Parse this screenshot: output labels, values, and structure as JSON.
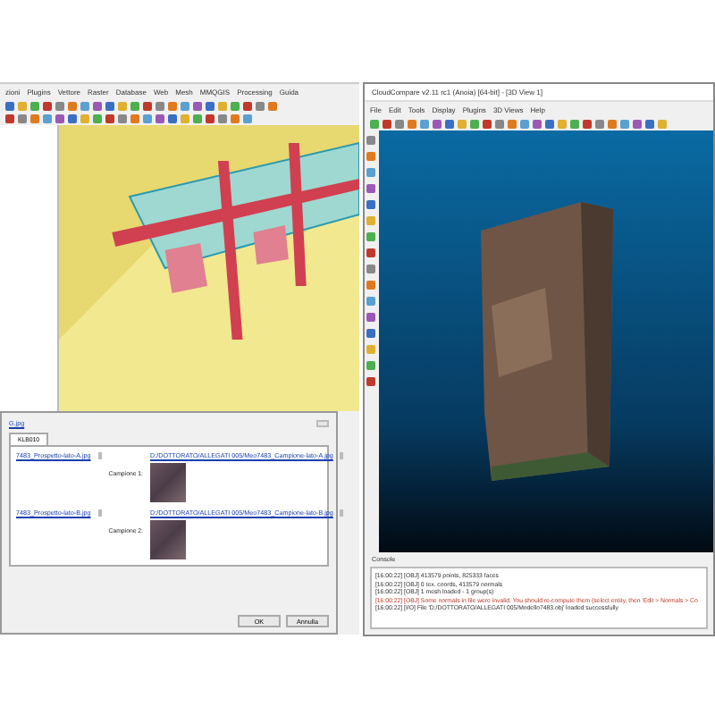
{
  "qgis": {
    "menu": [
      "zioni",
      "Plugins",
      "Vettore",
      "Raster",
      "Database",
      "Web",
      "Mesh",
      "MMQGIS",
      "Processing",
      "Guida"
    ],
    "dialog": {
      "top_link": "G.jpg",
      "tabs": [
        {
          "label": "KLB010",
          "selected": true
        }
      ],
      "rows": [
        {
          "left_path": "7483_Prospetto-lato-A.jpg",
          "right_path": "D:/DOTTORATO/ALLEGATI 005/Meo7483_Campione-lato-A.jpg",
          "caption": "Campione 1:"
        },
        {
          "left_path": "7483_Prospetto-lato-B.jpg",
          "right_path": "D:/DOTTORATO/ALLEGATI 005/Meo7483_Campione-lato-B.jpg",
          "caption": "Campione 2:"
        }
      ],
      "buttons": [
        "OK",
        "Annulla"
      ]
    }
  },
  "cloudcompare": {
    "title": "CloudCompare v2.11 rc1 (Anoia) [64-bit] - [3D View 1]",
    "menu": [
      "File",
      "Edit",
      "Tools",
      "Display",
      "Plugins",
      "3D Views",
      "Help"
    ],
    "console": {
      "title": "Console",
      "lines": [
        {
          "text": "[16:00:22] [OBJ] 413579 points, 825333 faces",
          "kind": "info"
        },
        {
          "text": "[16:00:22] [OBJ] 0 tex. coords, 413579 normals",
          "kind": "info"
        },
        {
          "text": "[16:00:22] [OBJ] 1 mesh loaded - 1 group(s)",
          "kind": "info"
        },
        {
          "text": "[16:00:22] [OBJ] Some normals in file were invalid. You should re-compute them (select entity, then 'Edit > Normals > Co",
          "kind": "warning"
        },
        {
          "text": "[16:00:22] [I/O] File 'D:/DOTTORATO/ALLEGATI 005/Modello7483.obj' loaded successfully",
          "kind": "info"
        }
      ]
    }
  }
}
